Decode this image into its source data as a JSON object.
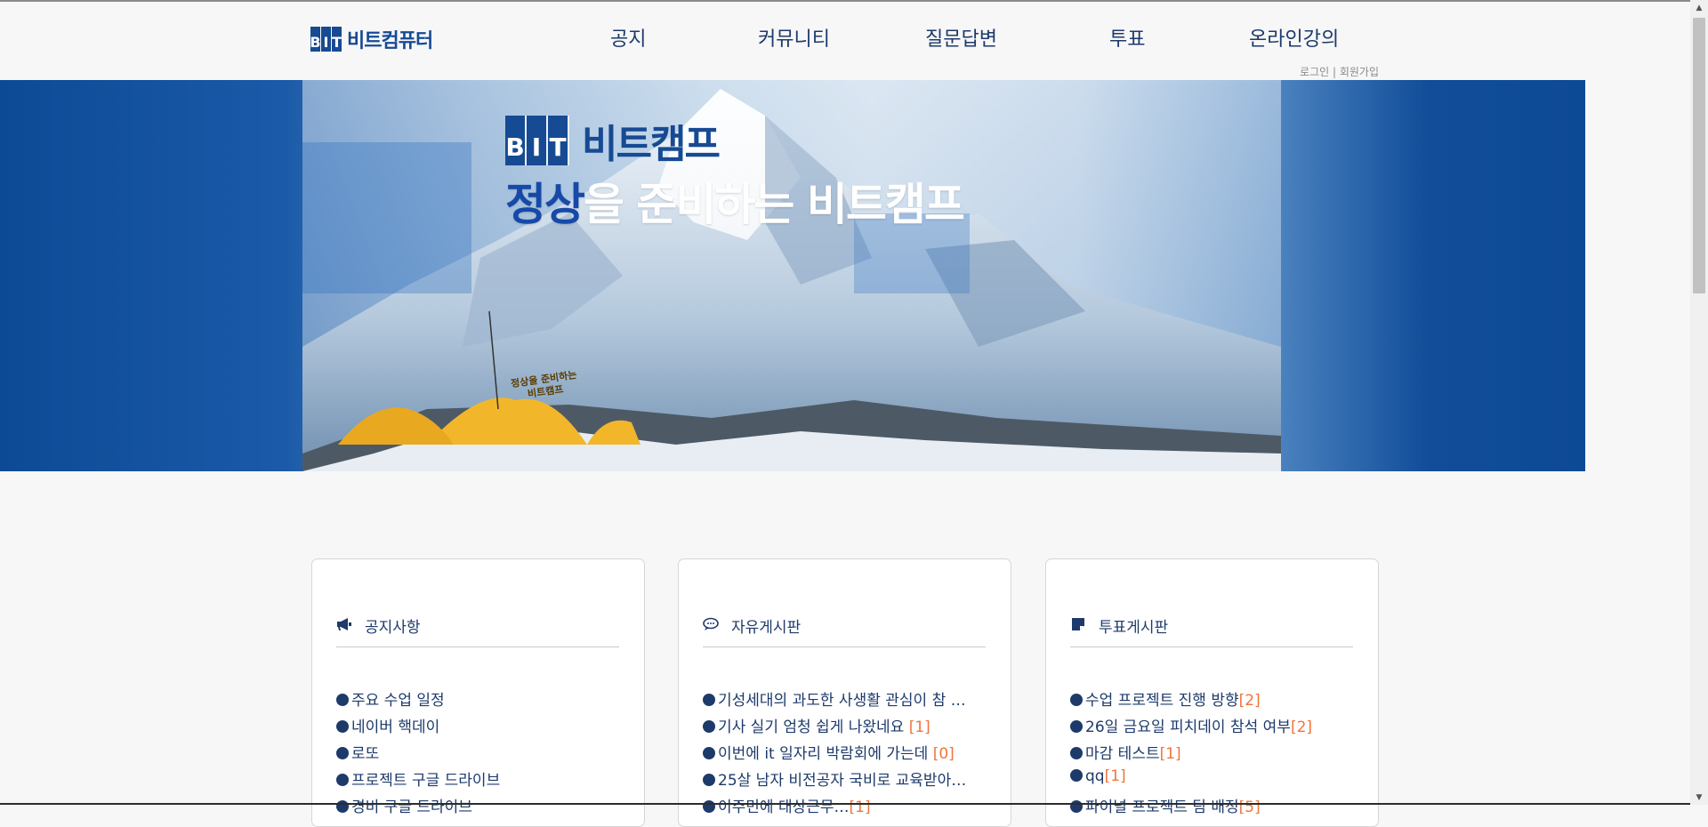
{
  "header": {
    "logo_letters": [
      "B",
      "I",
      "T"
    ],
    "logo_text": "비트컴퓨터",
    "nav": [
      "공지",
      "커뮤니티",
      "질문답변",
      "투표",
      "온라인강의"
    ],
    "auth": {
      "login": "로그인",
      "separator": " | ",
      "signup": "회원가입"
    }
  },
  "hero": {
    "logo_letters": [
      "B",
      "I",
      "T"
    ],
    "logo_text": "비트캠프",
    "slogan_highlight": "정상",
    "slogan_rest": "을 준비하는 비트캠프",
    "tent_text_1": "정상을 준비하는",
    "tent_text_2": "비트캠프"
  },
  "cards": [
    {
      "title": "공지사항",
      "icon": "megaphone-icon",
      "items": [
        {
          "text": "주요 수업 일정",
          "count": ""
        },
        {
          "text": "네이버 핵데이",
          "count": ""
        },
        {
          "text": "로또",
          "count": ""
        },
        {
          "text": "프로젝트 구글 드라이브",
          "count": ""
        },
        {
          "text": "경비 구글 드라이브",
          "count": ""
        }
      ]
    },
    {
      "title": "자유게시판",
      "icon": "speech-bubble-icon",
      "items": [
        {
          "text": "기성세대의 과도한 사생활 관심이 참 …",
          "count": ""
        },
        {
          "text": "기사 실기 엄청 쉽게 나왔네요 ",
          "count": "[1]"
        },
        {
          "text": "이번에 it 일자리 박람회에 가는데 ",
          "count": "[0]"
        },
        {
          "text": "25살 남자 비전공자 국비로 교육받아…",
          "count": ""
        },
        {
          "text": "이주민에 대상근무…",
          "count": "[1]"
        }
      ]
    },
    {
      "title": "투표게시판",
      "icon": "note-icon",
      "items": [
        {
          "text": "수업 프로젝트 진행 방향",
          "count": "[2]"
        },
        {
          "text": "26일 금요일 피치데이 참석 여부",
          "count": "[2]"
        },
        {
          "text": "마감 테스트",
          "count": "[1]"
        },
        {
          "text": "qq",
          "count": "[1]"
        },
        {
          "text": "파이널 프로젝트 팀 배정",
          "count": "[5]"
        }
      ]
    }
  ],
  "colors": {
    "brand": "#164a93",
    "text": "#1d3a6b",
    "count": "#f0743a",
    "hero_blue": "#0d4a96"
  }
}
